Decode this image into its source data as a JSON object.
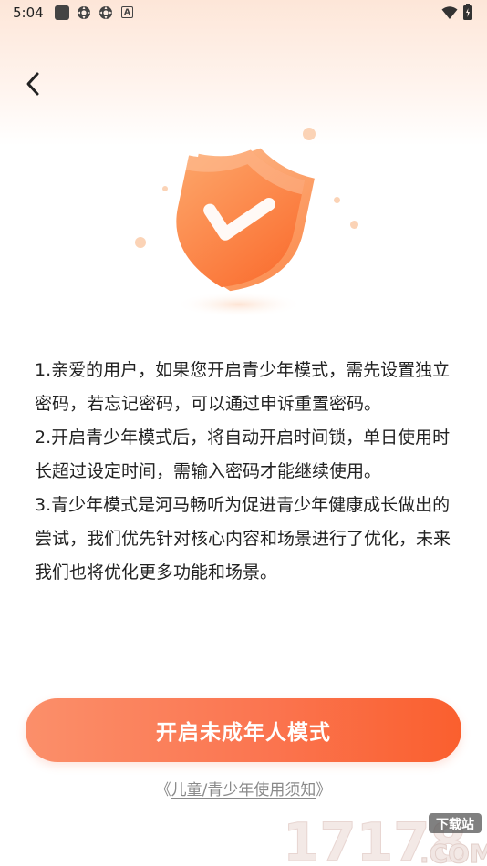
{
  "status_bar": {
    "time": "5:04",
    "icons": [
      "notification-square-icon",
      "gear-icon",
      "gear-icon",
      "a-box-icon",
      "wifi-icon",
      "battery-icon"
    ]
  },
  "header": {
    "back_icon": "chevron-left-icon"
  },
  "illustration": {
    "icon": "shield-check-icon",
    "colors": {
      "shield": "#fb7a3f",
      "shield_light": "#fda66a",
      "check": "#ffffff"
    }
  },
  "content": {
    "paragraphs": [
      "1.亲爱的用户，如果您开启青少年模式，需先设置独立密码，若忘记密码，可以通过申诉重置密码。",
      "2.开启青少年模式后，将自动开启时间锁，单日使用时长超过设定时间，需输入密码才能继续使用。",
      "3.青少年模式是河马畅听为促进青少年健康成长做出的尝试，我们优先针对核心内容和场景进行了优化，未来我们也将优化更多功能和场景。"
    ]
  },
  "actions": {
    "enable_button_label": "开启未成年人模式",
    "notice_link_open": "《",
    "notice_link_label": "儿童/青少年使用须知",
    "notice_link_close": "》"
  },
  "watermark": {
    "number": "17178",
    "badge": "下载站",
    "suffix": ".COM"
  },
  "colors": {
    "accent": "#fa6a3c",
    "text": "#222222",
    "link": "#8a8a8a"
  }
}
